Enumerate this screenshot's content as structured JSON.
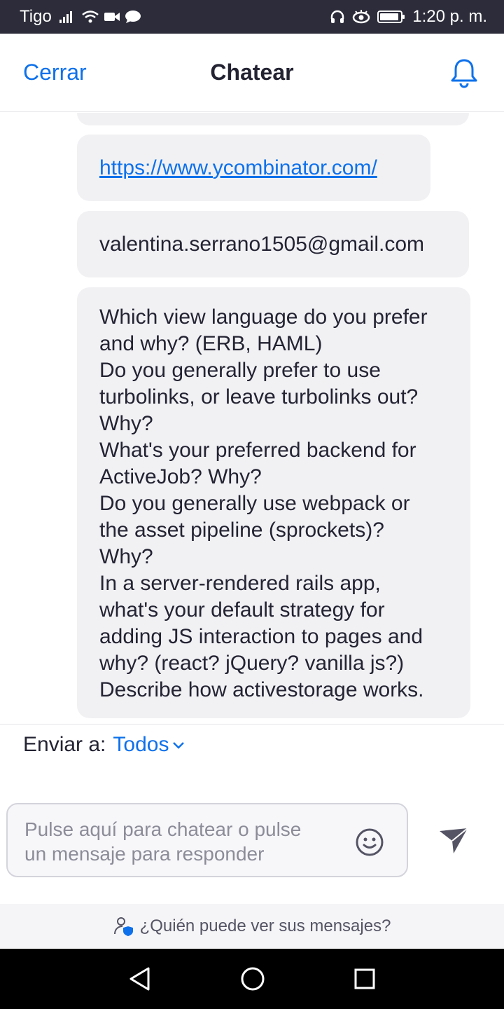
{
  "status_bar": {
    "carrier": "Tigo",
    "time": "1:20 p. m."
  },
  "header": {
    "close_label": "Cerrar",
    "title": "Chatear"
  },
  "messages": [
    {
      "text": "https://www.ycombinator.com/"
    },
    {
      "text": "valentina.serrano1505@gmail.com"
    },
    {
      "lines": [
        "Which view language do you prefer",
        "and why? (ERB, HAML)",
        "Do you generally prefer to use",
        "turbolinks, or leave turbolinks out?",
        "Why?",
        "What's your preferred backend for",
        "ActiveJob? Why?",
        "Do you generally use webpack or",
        "the asset pipeline (sprockets)?",
        "Why?",
        "In a server-rendered rails app,",
        "what's your default strategy for",
        "adding JS interaction to pages and",
        "why? (react? jQuery? vanilla js?)",
        "Describe how activestorage works."
      ]
    }
  ],
  "composer": {
    "send_to_label": "Enviar a:",
    "send_to_value": "Todos",
    "placeholder_line1": "Pulse aquí para chatear o pulse",
    "placeholder_line2": "un mensaje para responder"
  },
  "privacy": {
    "label": "¿Quién puede ver sus mensajes?"
  },
  "colors": {
    "accent": "#0e71eb",
    "status_bar": "#2c2c3a",
    "bubble": "#f1f1f4"
  }
}
